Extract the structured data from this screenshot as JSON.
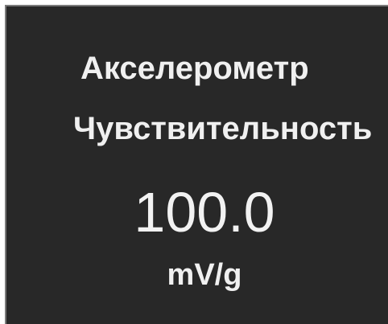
{
  "panel": {
    "title": "Акселерометр",
    "parameter_label": "Чувствительность",
    "value": "100.0",
    "unit": "mV/g"
  },
  "colors": {
    "background": "#282828",
    "text": "#f0f0f0",
    "border": "#7a7a7a",
    "page": "#ffffff"
  }
}
